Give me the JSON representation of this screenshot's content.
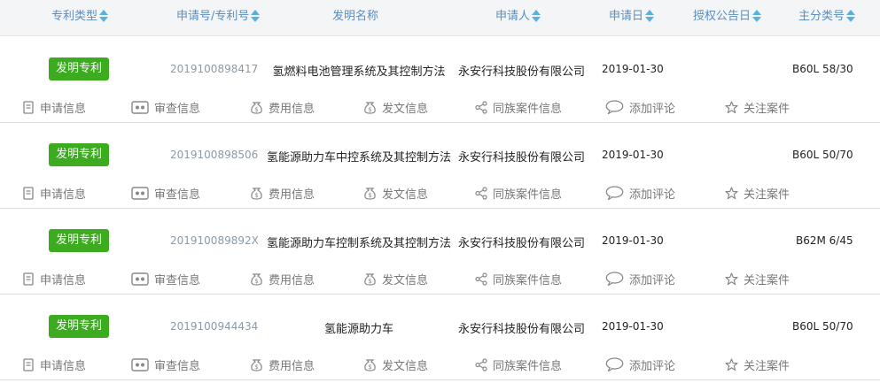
{
  "header": {
    "columns": [
      {
        "label": "专利类型"
      },
      {
        "label": "申请号/专利号"
      },
      {
        "label": "发明名称"
      },
      {
        "label": "申请人"
      },
      {
        "label": "申请日"
      },
      {
        "label": "授权公告日"
      },
      {
        "label": "主分类号"
      }
    ]
  },
  "actions": {
    "application_info": "申请信息",
    "examination_info": "审查信息",
    "fee_info": "费用信息",
    "document_info": "发文信息",
    "family_cases": "同族案件信息",
    "add_comment": "添加评论",
    "follow_case": "关注案件"
  },
  "rows": [
    {
      "type": "发明专利",
      "app_no": "2019100898417",
      "title": "氢燃料电池管理系统及其控制方法",
      "applicant": "永安行科技股份有限公司",
      "date": "2019-01-30",
      "grant_date": "",
      "class": "B60L 58/30"
    },
    {
      "type": "发明专利",
      "app_no": "2019100898506",
      "title": "氢能源助力车中控系统及其控制方法",
      "applicant": "永安行科技股份有限公司",
      "date": "2019-01-30",
      "grant_date": "",
      "class": "B60L 50/70"
    },
    {
      "type": "发明专利",
      "app_no": "201910089892X",
      "title": "氢能源助力车控制系统及其控制方法",
      "applicant": "永安行科技股份有限公司",
      "date": "2019-01-30",
      "grant_date": "",
      "class": "B62M 6/45"
    },
    {
      "type": "发明专利",
      "app_no": "2019100944434",
      "title": "氢能源助力车",
      "applicant": "永安行科技股份有限公司",
      "date": "2019-01-30",
      "grant_date": "",
      "class": "B60L 50/70"
    }
  ],
  "colors": {
    "badge": "#3cab1f",
    "header_text": "#5b8dbf",
    "sort_arrow": "#5ab0df"
  }
}
